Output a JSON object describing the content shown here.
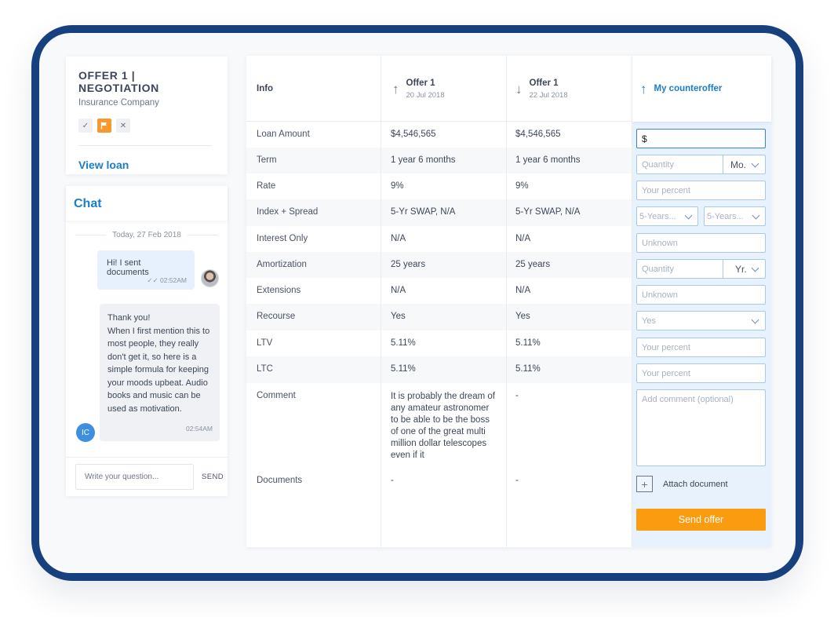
{
  "offer": {
    "title": "OFFER 1 | NEGOTIATION",
    "company": "Insurance Company",
    "status_icons": [
      "check-icon",
      "flag-icon",
      "close-icon"
    ],
    "view_loan": "View loan"
  },
  "chat": {
    "title": "Chat",
    "date": "Today, 27 Feb 2018",
    "messages": [
      {
        "text": "Hi! I sent documents",
        "time": "02:52AM",
        "direction": "out"
      },
      {
        "text": "Thank you!\nWhen I first mention this to most people, they really don't get it, so here is a simple formula for keeping your moods upbeat. Audio books and music can be used as motivation.",
        "time": "02:54AM",
        "direction": "in",
        "avatar": "IC"
      }
    ],
    "input_placeholder": "Write your question...",
    "send": "SEND"
  },
  "table": {
    "headers": {
      "info": "Info",
      "offer1": {
        "label": "Offer 1",
        "date": "20 Jul 2018"
      },
      "offer2": {
        "label": "Offer 1",
        "date": "22 Jul 2018"
      },
      "counter": "My counteroffer"
    },
    "rows": [
      {
        "label": "Loan Amount",
        "a": "$4,546,565",
        "b": "$4,546,565"
      },
      {
        "label": "Term",
        "a": "1 year 6 months",
        "b": "1 year 6 months"
      },
      {
        "label": "Rate",
        "a": "9%",
        "b": "9%"
      },
      {
        "label": "Index + Spread",
        "a": "5-Yr SWAP, N/A",
        "b": "5-Yr SWAP, N/A"
      },
      {
        "label": "Interest Only",
        "a": "N/A",
        "b": "N/A"
      },
      {
        "label": "Amortization",
        "a": "25 years",
        "b": "25 years"
      },
      {
        "label": "Extensions",
        "a": "N/A",
        "b": "N/A"
      },
      {
        "label": "Recourse",
        "a": "Yes",
        "b": "Yes"
      },
      {
        "label": "LTV",
        "a": "5.11%",
        "b": "5.11%"
      },
      {
        "label": "LTC",
        "a": "5.11%",
        "b": "5.11%"
      },
      {
        "label": "Comment",
        "a": "It is probably the dream of any amateur astronomer to be able to be the boss of one of the great multi million dollar telescopes even if it",
        "b": "-"
      },
      {
        "label": "Documents",
        "a": "-",
        "b": "-"
      }
    ]
  },
  "counteroffer": {
    "loan_amount_value": "$",
    "term_placeholder": "Quantity",
    "term_unit": "Mo.",
    "rate_placeholder": "Your percent",
    "index_placeholder": "5-Years...",
    "spread_placeholder": "5-Years...",
    "interest_only_placeholder": "Unknown",
    "amortization_placeholder": "Quantity",
    "amortization_unit": "Yr.",
    "extensions_placeholder": "Unknown",
    "recourse_value": "Yes",
    "ltv_placeholder": "Your percent",
    "ltc_placeholder": "Your percent",
    "comment_placeholder": "Add comment (optional)",
    "attach": "Attach document",
    "send_offer": "Send offer"
  },
  "colors": {
    "frame": "#17407e",
    "accent_blue": "#1a7fc8",
    "accent_orange": "#fb9c10",
    "counter_bg": "#e7f2fd"
  }
}
